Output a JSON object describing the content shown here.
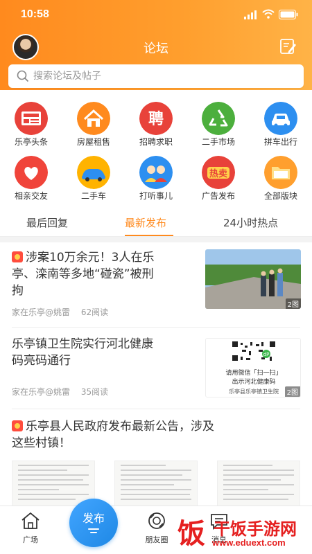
{
  "status": {
    "time": "10:58"
  },
  "header": {
    "title": "论坛",
    "avatar": "user-avatar",
    "edit_icon": "edit-icon"
  },
  "search": {
    "placeholder": "搜索论坛及帖子"
  },
  "categories": [
    {
      "label": "乐亭头条",
      "icon": "news-icon",
      "color": "#e8423a"
    },
    {
      "label": "房屋租售",
      "icon": "house-icon",
      "color": "#ff8a1e"
    },
    {
      "label": "招聘求职",
      "icon": "recruit-icon",
      "color": "#e8423a"
    },
    {
      "label": "二手市场",
      "icon": "recycle-icon",
      "color": "#4caf3d"
    },
    {
      "label": "拼车出行",
      "icon": "carpool-icon",
      "color": "#2d8ff0"
    },
    {
      "label": "相亲交友",
      "icon": "heart-icon",
      "color": "#f0443a"
    },
    {
      "label": "二手车",
      "icon": "used-car-icon",
      "color": "#ffb300"
    },
    {
      "label": "打听事儿",
      "icon": "people-icon",
      "color": "#2d8ff0"
    },
    {
      "label": "广告发布",
      "icon": "hot-sale-icon",
      "color": "#e8423a"
    },
    {
      "label": "全部版块",
      "icon": "folder-icon",
      "color": "#ff9f2e"
    }
  ],
  "tabs": [
    {
      "label": "最后回复",
      "active": false
    },
    {
      "label": "最新发布",
      "active": true
    },
    {
      "label": "24小时热点",
      "active": false
    }
  ],
  "posts": [
    {
      "title_line1": "涉案10万余元！3人在乐",
      "title_line2": "亭、滦南等多地“碰瓷”被刑",
      "title_line3": "拘",
      "author": "家在乐亭@姚雷",
      "reads": "62阅读",
      "image_count": "2图"
    },
    {
      "title_line1": "乐亭镇卫生院实行河北健康",
      "title_line2": "码亮码通行",
      "author": "家在乐亭@姚雷",
      "reads": "35阅读",
      "image_count": "2图",
      "image_text_line1": "请用微信「扫一扫」",
      "image_text_line2": "出示河北健康码",
      "image_text_line3": "乐亭县乐亭镇卫生院"
    },
    {
      "title_line1": "乐亭县人民政府发布最新公告，涉及",
      "title_line2": "这些村镇！"
    }
  ],
  "bottom_nav": [
    {
      "label": "广场",
      "icon": "home-icon"
    },
    {
      "label": "发布",
      "icon": "publish-icon"
    },
    {
      "label": "朋友圈",
      "icon": "camera-icon"
    },
    {
      "label": "消息",
      "icon": "message-icon"
    }
  ],
  "watermark": {
    "char": "饭",
    "name": "干饭手游网",
    "url": "www.eduext.com"
  }
}
